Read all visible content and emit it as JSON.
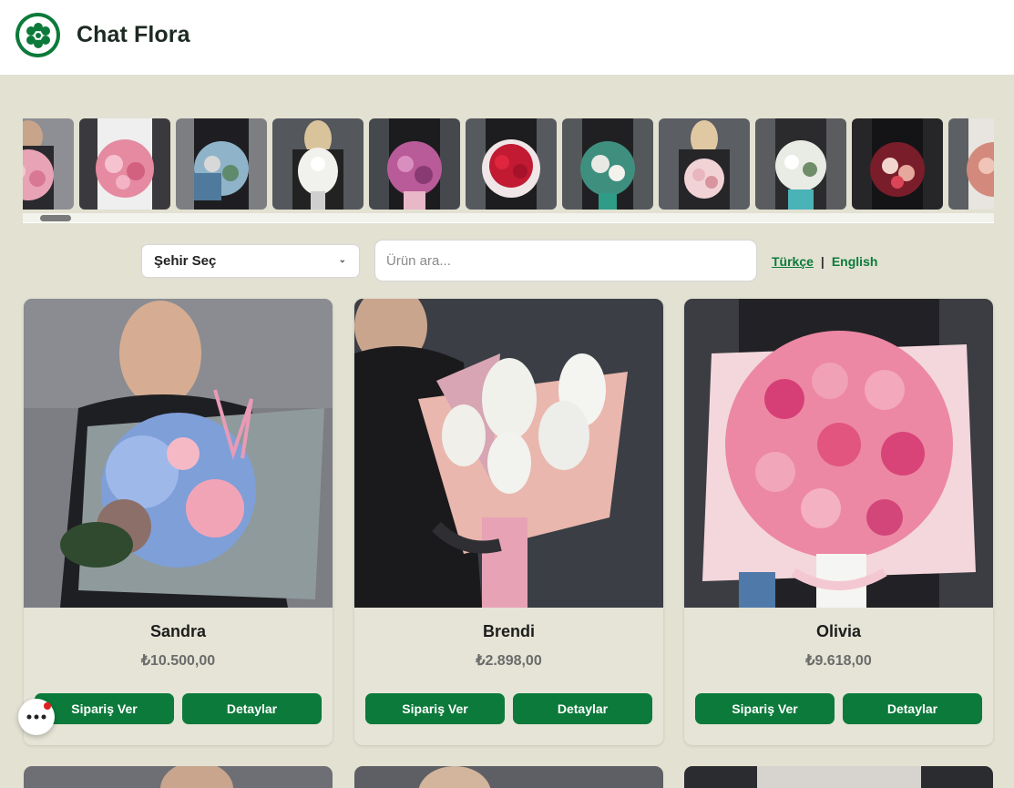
{
  "header": {
    "brand": "Chat Flora",
    "logo_icon": "flower-logo-icon"
  },
  "controls": {
    "city_select_value": "Şehir Seç",
    "search_placeholder": "Ürün ara...",
    "languages": [
      "Türkçe",
      "English"
    ],
    "language_separator": "|",
    "active_language": "Türkçe"
  },
  "products": [
    {
      "name": "Sandra",
      "price": "₺10.500,00",
      "order_label": "Sipariş Ver",
      "details_label": "Detaylar"
    },
    {
      "name": "Brendi",
      "price": "₺2.898,00",
      "order_label": "Sipariş Ver",
      "details_label": "Detaylar"
    },
    {
      "name": "Olivia",
      "price": "₺9.618,00",
      "order_label": "Sipariş Ver",
      "details_label": "Detaylar"
    }
  ],
  "colors": {
    "accent": "#0c7a3a",
    "background": "#e2e1d2",
    "notification": "#e02020"
  }
}
